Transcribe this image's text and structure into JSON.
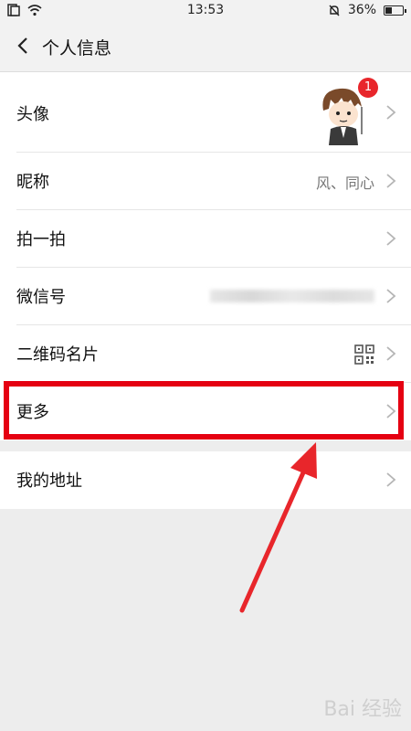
{
  "status": {
    "time": "13:53",
    "battery": "36%",
    "battery_level": 0.36
  },
  "header": {
    "title": "个人信息"
  },
  "rows": [
    {
      "label": "头像",
      "badge": "1"
    },
    {
      "label": "昵称",
      "value": "风、同心"
    },
    {
      "label": "拍一拍"
    },
    {
      "label": "微信号"
    },
    {
      "label": "二维码名片"
    },
    {
      "label": "更多"
    },
    {
      "label": "我的地址"
    }
  ],
  "icons": {
    "back": "chevron-left-icon",
    "row_arrow": "chevron-right-icon",
    "qr": "qr-code-icon",
    "sim": "sim-card-icon",
    "wifi": "wifi-icon",
    "mute": "mute-icon",
    "battery": "battery-icon"
  },
  "colors": {
    "highlight": "#e50012",
    "annotation_arrow": "#e8262b",
    "background": "#ededed"
  },
  "watermark": "Bai 经验"
}
